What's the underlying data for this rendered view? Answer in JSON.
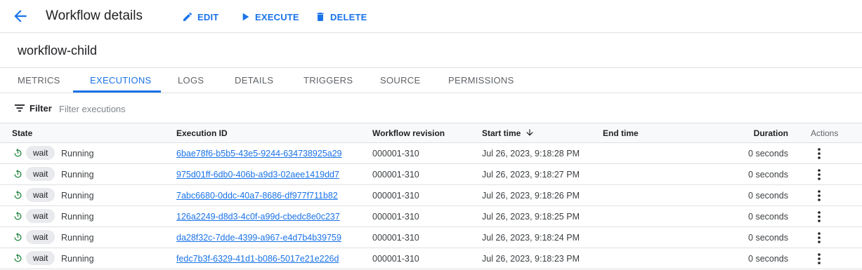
{
  "header": {
    "title": "Workflow details",
    "actions": {
      "edit": "EDIT",
      "execute": "EXECUTE",
      "delete": "DELETE"
    }
  },
  "workflow": {
    "name": "workflow-child"
  },
  "tabs": [
    {
      "label": "METRICS",
      "active": false
    },
    {
      "label": "EXECUTIONS",
      "active": true
    },
    {
      "label": "LOGS",
      "active": false
    },
    {
      "label": "DETAILS",
      "active": false
    },
    {
      "label": "TRIGGERS",
      "active": false
    },
    {
      "label": "SOURCE",
      "active": false
    },
    {
      "label": "PERMISSIONS",
      "active": false
    }
  ],
  "filter": {
    "label": "Filter",
    "placeholder": "Filter executions"
  },
  "table": {
    "columns": {
      "state": "State",
      "execution_id": "Execution ID",
      "revision": "Workflow revision",
      "start_time": "Start time",
      "end_time": "End time",
      "duration": "Duration",
      "actions": "Actions"
    },
    "rows": [
      {
        "chip": "wait",
        "state": "Running",
        "id": "6bae78f6-b5b5-43e5-9244-634738925a29",
        "revision": "000001-310",
        "start": "Jul 26, 2023, 9:18:28 PM",
        "end": "",
        "duration": "0 seconds"
      },
      {
        "chip": "wait",
        "state": "Running",
        "id": "975d01ff-6db0-406b-a9d3-02aee1419dd7",
        "revision": "000001-310",
        "start": "Jul 26, 2023, 9:18:27 PM",
        "end": "",
        "duration": "0 seconds"
      },
      {
        "chip": "wait",
        "state": "Running",
        "id": "7abc6680-0ddc-40a7-8686-df977f711b82",
        "revision": "000001-310",
        "start": "Jul 26, 2023, 9:18:26 PM",
        "end": "",
        "duration": "0 seconds"
      },
      {
        "chip": "wait",
        "state": "Running",
        "id": "126a2249-d8d3-4c0f-a99d-cbedc8e0c237",
        "revision": "000001-310",
        "start": "Jul 26, 2023, 9:18:25 PM",
        "end": "",
        "duration": "0 seconds"
      },
      {
        "chip": "wait",
        "state": "Running",
        "id": "da28f32c-7dde-4399-a967-e4d7b4b39759",
        "revision": "000001-310",
        "start": "Jul 26, 2023, 9:18:24 PM",
        "end": "",
        "duration": "0 seconds"
      },
      {
        "chip": "wait",
        "state": "Running",
        "id": "fedc7b3f-6329-41d1-b086-5017e21e226d",
        "revision": "000001-310",
        "start": "Jul 26, 2023, 9:18:23 PM",
        "end": "",
        "duration": "0 seconds"
      }
    ]
  },
  "colors": {
    "accent": "#1a73e8",
    "running": "#188038",
    "chip_bg": "#e8eaed"
  }
}
